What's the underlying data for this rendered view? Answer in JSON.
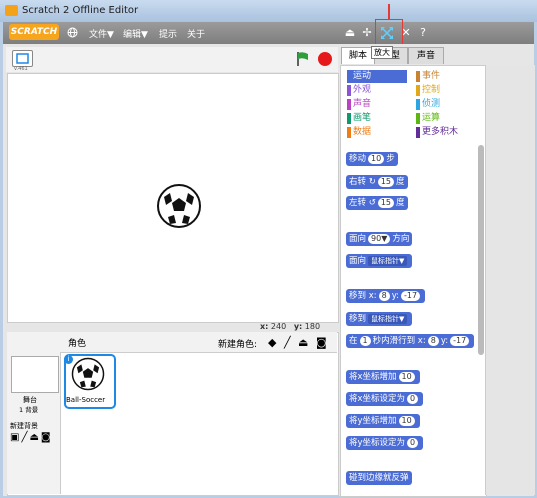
{
  "window": {
    "title": "Scratch 2 Offline Editor"
  },
  "menubar": {
    "logo": "SCRATCH",
    "items": [
      "文件▼",
      "编辑▼",
      "提示",
      "关于"
    ],
    "tooltip": "放大"
  },
  "stage": {
    "version": "v.461",
    "coord_x_label": "x:",
    "coord_x": "240",
    "coord_y_label": "y:",
    "coord_y": "180"
  },
  "sprites": {
    "header": "角色",
    "new_sprite_label": "新建角色:",
    "stage_label": "舞台",
    "stage_backdrops": "1 背景",
    "new_backdrop_label": "新建背景",
    "sprite_name": "Ball-Soccer"
  },
  "tabs": [
    "脚本",
    "造型",
    "声音"
  ],
  "categories": [
    {
      "label": "运动",
      "color": "#4a6cd4"
    },
    {
      "label": "事件",
      "color": "#c88330"
    },
    {
      "label": "外观",
      "color": "#8a55d7"
    },
    {
      "label": "控制",
      "color": "#e1a91a"
    },
    {
      "label": "声音",
      "color": "#bb42c3"
    },
    {
      "label": "侦测",
      "color": "#2ca5e2"
    },
    {
      "label": "画笔",
      "color": "#0e9a6c"
    },
    {
      "label": "运算",
      "color": "#5cb712"
    },
    {
      "label": "数据",
      "color": "#ee7d16"
    },
    {
      "label": "更多积木",
      "color": "#632d99"
    }
  ],
  "blocks": {
    "move": {
      "pre": "移动",
      "val": "10",
      "post": "步"
    },
    "turn_right": {
      "pre": "右转",
      "val": "15",
      "post": "度"
    },
    "turn_left": {
      "pre": "左转",
      "val": "15",
      "post": "度"
    },
    "point_dir": {
      "pre": "面向",
      "val": "90▼",
      "post": "方向"
    },
    "point_toward": {
      "pre": "面向",
      "val": "鼠标指针▼"
    },
    "goto_xy": {
      "pre": "移到 x:",
      "x": "8",
      "mid": "y:",
      "y": "-17"
    },
    "goto": {
      "pre": "移到",
      "val": "鼠标指针▼"
    },
    "glide": {
      "pre": "在",
      "sec": "1",
      "mid": "秒内滑行到 x:",
      "x": "8",
      "mid2": "y:",
      "y": "-17"
    },
    "change_x": {
      "pre": "将x坐标增加",
      "val": "10"
    },
    "set_x": {
      "pre": "将x坐标设定为",
      "val": "0"
    },
    "change_y": {
      "pre": "将y坐标增加",
      "val": "10"
    },
    "set_y": {
      "pre": "将y坐标设定为",
      "val": "0"
    },
    "bounce": {
      "pre": "碰到边缘就反弹"
    }
  }
}
